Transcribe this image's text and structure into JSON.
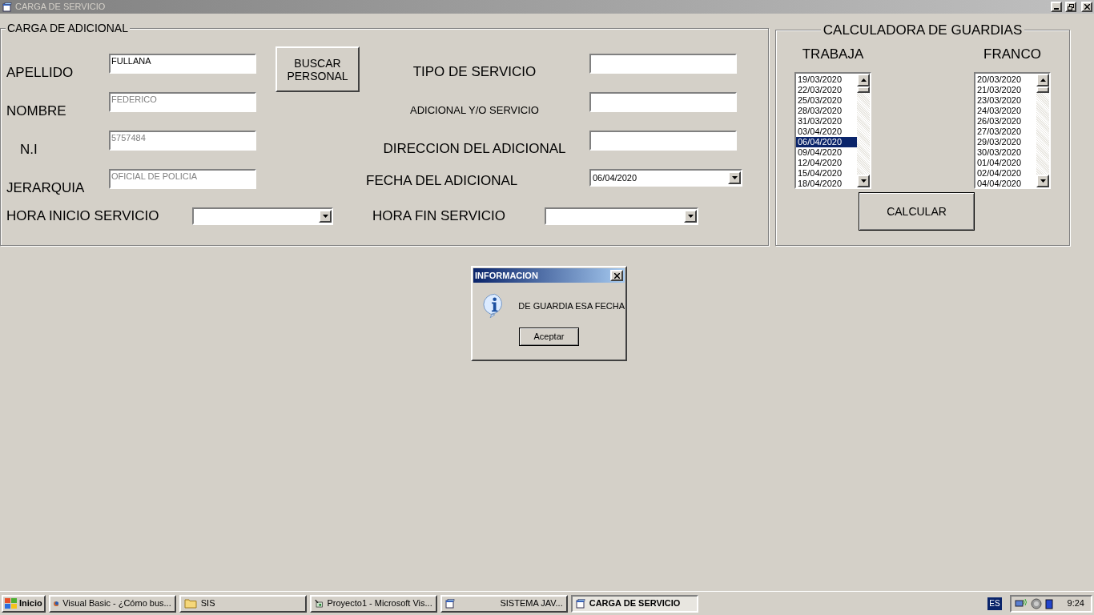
{
  "window": {
    "title": "CARGA DE SERVICIO"
  },
  "form": {
    "title": "CARGA DE ADICIONAL",
    "search_button": "BUSCAR PERSONAL",
    "fields_left": [
      {
        "label": "APELLIDO",
        "value": "FULLANA",
        "disabled": false
      },
      {
        "label": "NOMBRE",
        "value": "FEDERICO",
        "disabled": true
      },
      {
        "label": "N.I",
        "value": "5757484",
        "disabled": true
      },
      {
        "label": "JERARQUIA",
        "value": "OFICIAL DE POLICIA",
        "disabled": true
      }
    ],
    "fields_right": [
      {
        "label": "TIPO DE SERVICIO",
        "kind": "text"
      },
      {
        "label": "ADICIONAL Y/O SERVICIO",
        "kind": "text"
      },
      {
        "label": "DIRECCION DEL ADICIONAL",
        "kind": "text"
      },
      {
        "label": "FECHA DEL ADICIONAL",
        "kind": "combo",
        "value": "06/04/2020"
      }
    ],
    "start_time": {
      "label": "HORA INICIO SERVICIO"
    },
    "end_time": {
      "label": "HORA FIN SERVICIO"
    }
  },
  "calculator": {
    "title": "CALCULADORA DE GUARDIAS",
    "button": "CALCULAR",
    "lists": [
      {
        "title": "TRABAJA",
        "items": [
          {
            "text": "19/03/2020",
            "selected": false
          },
          {
            "text": "22/03/2020",
            "selected": false
          },
          {
            "text": "25/03/2020",
            "selected": false
          },
          {
            "text": "28/03/2020",
            "selected": false
          },
          {
            "text": "31/03/2020",
            "selected": false
          },
          {
            "text": "03/04/2020",
            "selected": false
          },
          {
            "text": "06/04/2020",
            "selected": true
          },
          {
            "text": "09/04/2020",
            "selected": false
          },
          {
            "text": "12/04/2020",
            "selected": false
          },
          {
            "text": "15/04/2020",
            "selected": false
          },
          {
            "text": "18/04/2020",
            "selected": false
          }
        ]
      },
      {
        "title": "FRANCO",
        "items": [
          {
            "text": "20/03/2020",
            "selected": false
          },
          {
            "text": "21/03/2020",
            "selected": false
          },
          {
            "text": "23/03/2020",
            "selected": false
          },
          {
            "text": "24/03/2020",
            "selected": false
          },
          {
            "text": "26/03/2020",
            "selected": false
          },
          {
            "text": "27/03/2020",
            "selected": false
          },
          {
            "text": "29/03/2020",
            "selected": false
          },
          {
            "text": "30/03/2020",
            "selected": false
          },
          {
            "text": "01/04/2020",
            "selected": false
          },
          {
            "text": "02/04/2020",
            "selected": false
          },
          {
            "text": "04/04/2020",
            "selected": false
          }
        ]
      }
    ]
  },
  "dialog": {
    "title": "INFORMACION",
    "message": "DE GUARDIA ESA FECHA",
    "button": "Aceptar"
  },
  "taskbar": {
    "start": "Inicio",
    "tasks": [
      {
        "label": "Visual Basic - ¿Cómo bus...",
        "kind": "browser",
        "selected": false
      },
      {
        "label": "SIS",
        "kind": "folder",
        "selected": false
      },
      {
        "label": "Proyecto1 - Microsoft Vis...",
        "kind": "vb",
        "selected": false
      },
      {
        "label": "SISTEMA JAV...",
        "kind": "form",
        "selected": false
      },
      {
        "label": "CARGA DE SERVICIO",
        "kind": "form",
        "selected": true
      }
    ],
    "language": "ES",
    "time": "9:24"
  }
}
